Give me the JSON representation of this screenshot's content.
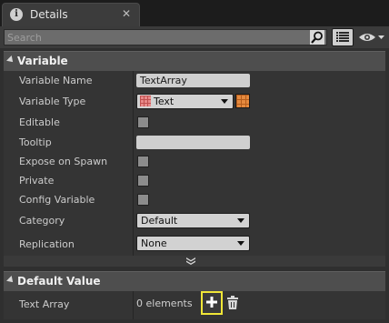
{
  "tab": {
    "title": "Details",
    "icon": "info-icon",
    "close_glyph": "✕"
  },
  "search": {
    "placeholder": "Search",
    "value": ""
  },
  "variable_section": {
    "title": "Variable",
    "rows": [
      {
        "label": "Variable Name",
        "control": "textbox",
        "value": "TextArray"
      },
      {
        "label": "Variable Type",
        "control": "type-combo",
        "value": "Text"
      },
      {
        "label": "Editable",
        "control": "checkbox",
        "checked": false
      },
      {
        "label": "Tooltip",
        "control": "textbox",
        "value": ""
      },
      {
        "label": "Expose on Spawn",
        "control": "checkbox",
        "checked": false
      },
      {
        "label": "Private",
        "control": "checkbox",
        "checked": false
      },
      {
        "label": "Config Variable",
        "control": "checkbox",
        "checked": false
      },
      {
        "label": "Category",
        "control": "combo",
        "value": "Default"
      },
      {
        "label": "Replication",
        "control": "combo",
        "value": "None"
      }
    ]
  },
  "default_section": {
    "title": "Default Value",
    "row": {
      "label": "Text Array",
      "value": "0 elements"
    }
  },
  "colors": {
    "highlight": "#f0e637",
    "type_color": "#e98a8a",
    "container_type_color": "#e58a3f"
  }
}
